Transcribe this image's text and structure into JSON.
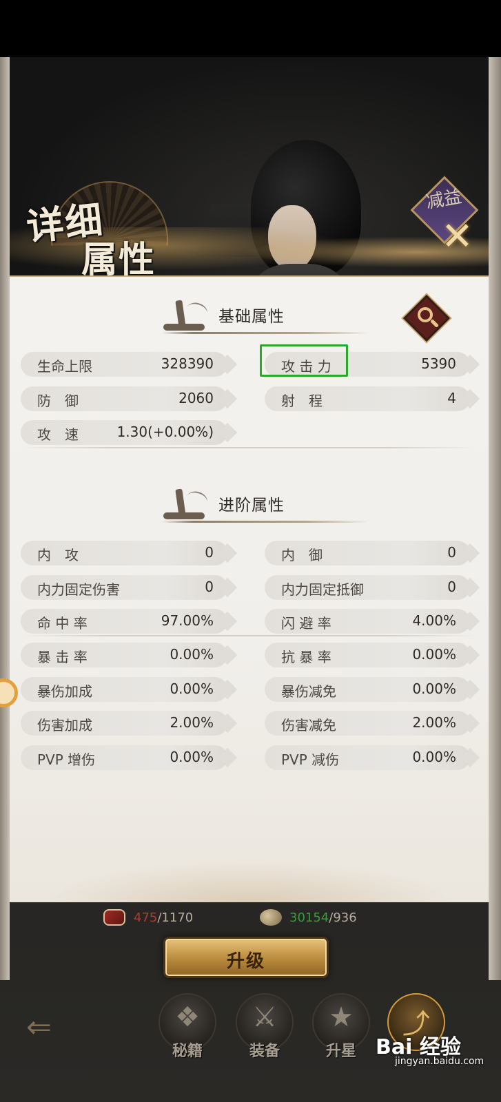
{
  "header": {
    "title_line1": "详细",
    "title_line2": "属性",
    "close_badge_text": "减益",
    "close_symbol": "✕"
  },
  "basic_section": {
    "title": "基础属性",
    "stats": [
      {
        "name": "生命上限",
        "value": "328390"
      },
      {
        "name": "攻 击 力",
        "value": "5390"
      },
      {
        "name": "防　御",
        "value": "2060"
      },
      {
        "name": "射　程",
        "value": "4"
      },
      {
        "name": "攻　速",
        "value": "1.30(+0.00%)"
      }
    ]
  },
  "advanced_section": {
    "title": "进阶属性",
    "stats": [
      {
        "name": "内　攻",
        "value": "0"
      },
      {
        "name": "内　御",
        "value": "0"
      },
      {
        "name": "内力固定伤害",
        "value": "0"
      },
      {
        "name": "内力固定抵御",
        "value": "0"
      },
      {
        "name": "命 中 率",
        "value": "97.00%"
      },
      {
        "name": "闪 避 率",
        "value": "4.00%"
      },
      {
        "name": "暴 击 率",
        "value": "0.00%"
      },
      {
        "name": "抗 暴 率",
        "value": "0.00%"
      },
      {
        "name": "暴伤加成",
        "value": "0.00%"
      },
      {
        "name": "暴伤减免",
        "value": "0.00%"
      },
      {
        "name": "伤害加成",
        "value": "2.00%"
      },
      {
        "name": "伤害减免",
        "value": "2.00%"
      },
      {
        "name": "PVP 增伤",
        "value": "0.00%"
      },
      {
        "name": "PVP 减伤",
        "value": "0.00%"
      }
    ]
  },
  "resources": {
    "books_current": "475",
    "books_required": "/1170",
    "coins_current": "30154",
    "coins_required": "/936"
  },
  "upgrade_button": {
    "label": "升级"
  },
  "bottom_nav": {
    "back_symbol": "⇐",
    "items": [
      {
        "label": "秘籍",
        "icon": "scroll-icon"
      },
      {
        "label": "装备",
        "icon": "crossed-swords-icon"
      },
      {
        "label": "升星",
        "icon": "star-hat-icon"
      },
      {
        "label": "",
        "icon": "hat-arrow-icon"
      }
    ]
  },
  "watermark": {
    "brand": "Bai 经验",
    "url": "jingyan.baidu.com"
  },
  "colors": {
    "highlight": "#29a829",
    "books_current": "#b13b33",
    "coins_current": "#3b9b3b",
    "upgrade_gold": "#b88a3c"
  }
}
